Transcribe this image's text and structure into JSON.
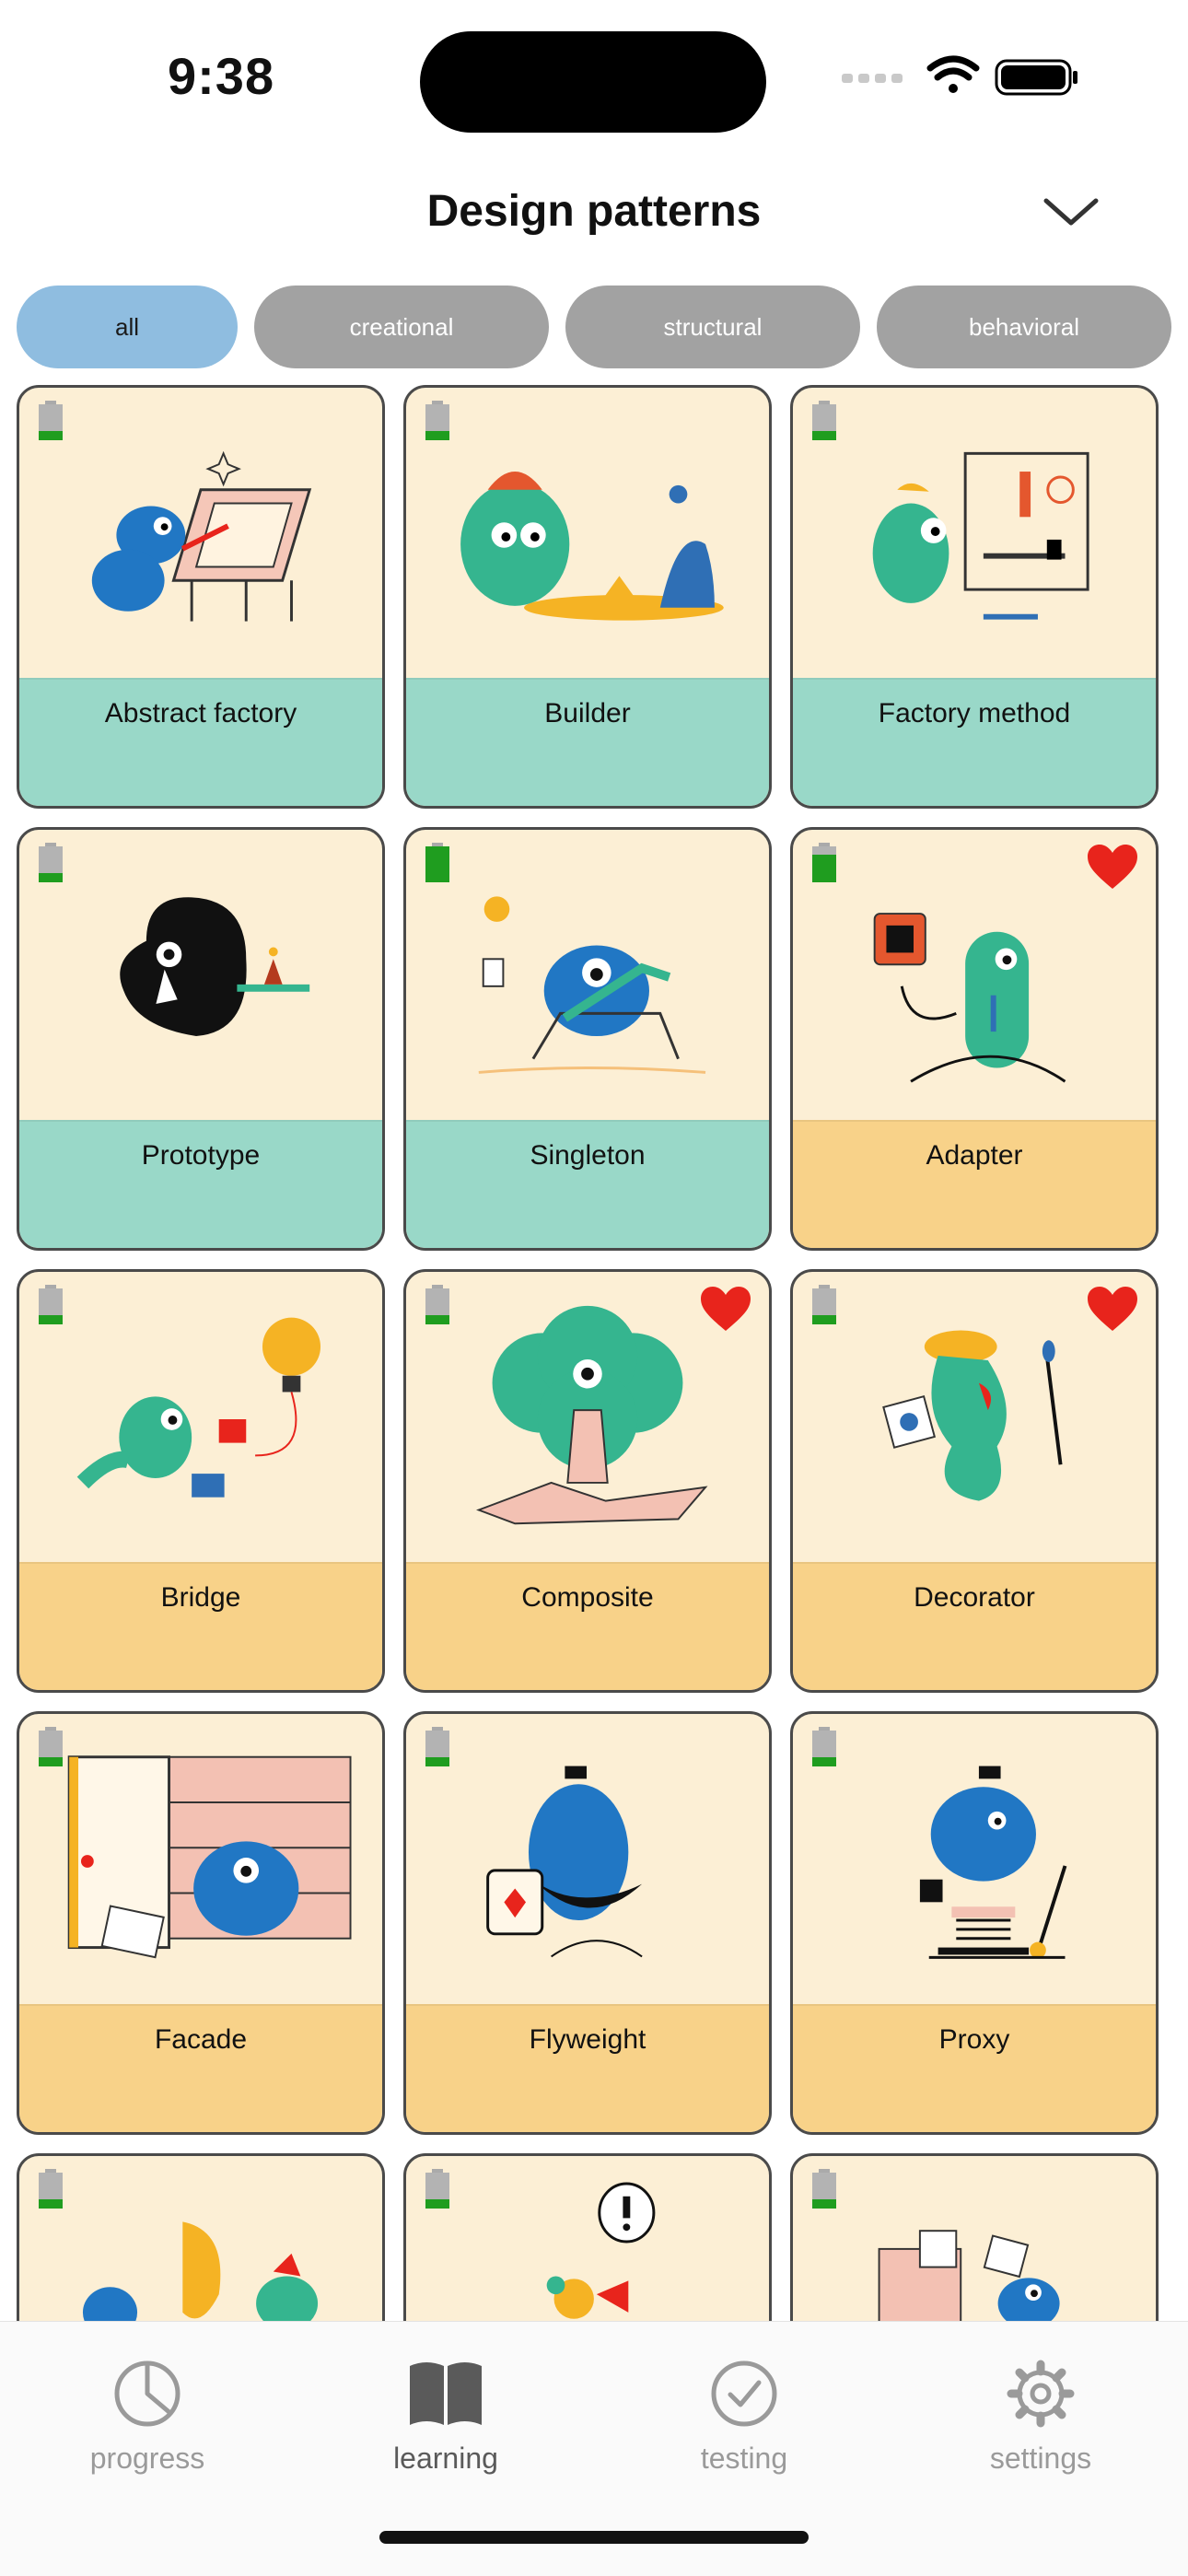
{
  "status_bar": {
    "time": "9:38"
  },
  "header": {
    "title": "Design patterns"
  },
  "filters": [
    {
      "label": "all",
      "active": true
    },
    {
      "label": "creational",
      "active": false
    },
    {
      "label": "structural",
      "active": false
    },
    {
      "label": "behavioral",
      "active": false
    }
  ],
  "cards": [
    {
      "title": "Abstract factory",
      "favorite": false
    },
    {
      "title": "Builder",
      "favorite": false
    },
    {
      "title": "Factory method",
      "favorite": false
    },
    {
      "title": "Prototype",
      "favorite": false
    },
    {
      "title": "Singleton",
      "favorite": false
    },
    {
      "title": "Adapter",
      "favorite": true
    },
    {
      "title": "Bridge",
      "favorite": false
    },
    {
      "title": "Composite",
      "favorite": true
    },
    {
      "title": "Decorator",
      "favorite": true
    },
    {
      "title": "Facade",
      "favorite": false
    },
    {
      "title": "Flyweight",
      "favorite": false
    },
    {
      "title": "Proxy",
      "favorite": false
    }
  ],
  "tabbar": {
    "items": [
      {
        "label": "progress",
        "icon": "pie-chart-icon",
        "active": false
      },
      {
        "label": "learning",
        "icon": "book-icon",
        "active": true
      },
      {
        "label": "testing",
        "icon": "checkmark-circle-icon",
        "active": false
      },
      {
        "label": "settings",
        "icon": "gear-icon",
        "active": false
      }
    ]
  },
  "colors": {
    "card_bg": "#fcefd5",
    "creational_band": "#99d8c8",
    "structural_band": "#f8d289",
    "active_pill": "#8fbde0",
    "inactive_pill": "#a2a2a2",
    "favorite_heart": "#e8241c",
    "battery_green": "#1f9d1f"
  }
}
